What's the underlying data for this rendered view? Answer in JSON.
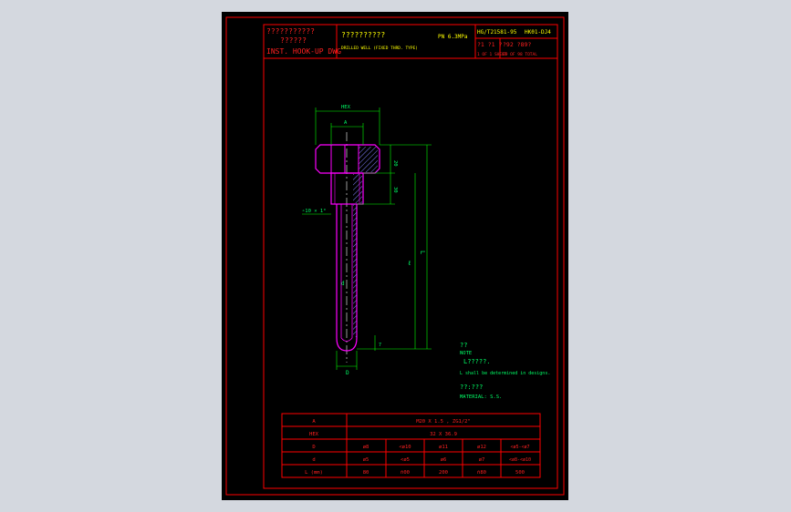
{
  "colors": {
    "page_bg": "#d4d8df",
    "canvas": "#000000",
    "frame": "#ff0000",
    "text_red": "#ff2020",
    "text_green": "#00ff66",
    "text_yellow": "#ffff00",
    "part": "#ff00ff",
    "dim": "#00ff00",
    "hatch": "#8080ff",
    "center": "#ffffff"
  },
  "title_block": {
    "cn_title_1": "???????????",
    "cn_title_2": "??????",
    "en_title": "INST. HOOK-UP DWG",
    "desc_cn": "??????????",
    "pressure": "PN 6.3MPa",
    "desc_en": "DRILLED WELL (FIXED THRD. TYPE)",
    "standard_no": "HG/T21581-95",
    "drawing_no": "HK01-DJ4",
    "sheet_cn": "?1 ?1 ?",
    "sheet_en": "1 OF 1 SHEET",
    "page_cn": "?92 ?89?",
    "page_en": "89 OF 98 TOTAL"
  },
  "drawing": {
    "dim_hex": "HEX",
    "dim_a": "A",
    "dim_20": "20",
    "dim_30": "30",
    "dim_angle": "∘10 × 1°",
    "dim_d": "d",
    "dim_l": "ℓ",
    "dim_L": "L",
    "dim_D": "D",
    "dim_7": "7"
  },
  "notes": {
    "note_cn": "??",
    "note_en": "NOTE",
    "note_line_cn": "L?????.",
    "note_line_en": "L shall be determined in designs.",
    "material_cn": "??:???",
    "material_en": "MATERIAL: S.S."
  },
  "table": {
    "rows": [
      {
        "label": "A",
        "merged": "M20 X 1.5  ,  ZG1/2\""
      },
      {
        "label": "HEX",
        "merged": "32 X 36.9"
      },
      {
        "label": "D",
        "cells": [
          "ø8",
          "<ø10",
          "ø11",
          "ø12",
          "<ø5-<ø7"
        ]
      },
      {
        "label": "d",
        "cells": [
          "ø5",
          "<ø5",
          "ø6",
          "ø7",
          "<ø8-<ø10"
        ]
      },
      {
        "label": "L (mm)",
        "cells": [
          "80",
          "ñ00",
          "200",
          "ñ80",
          "500"
        ]
      }
    ]
  }
}
